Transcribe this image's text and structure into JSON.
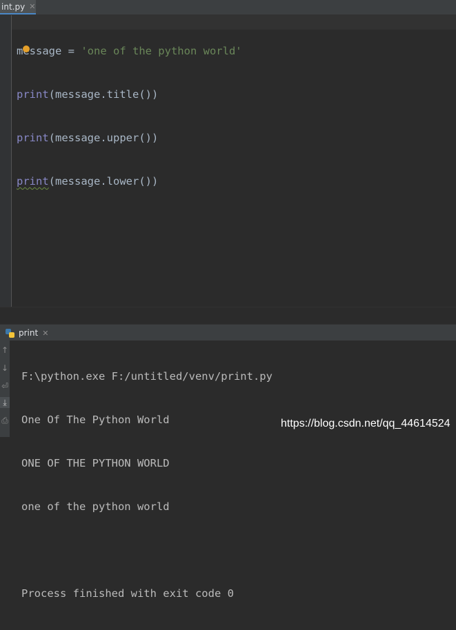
{
  "editor_tab": {
    "label": "int.py",
    "close": "✕"
  },
  "code": {
    "line1": {
      "var": "message = ",
      "str": "'one of the python world'"
    },
    "line2": {
      "kw": "print",
      "rest": "(message.title())"
    },
    "line3": {
      "kw": "print",
      "rest": "(message.upper())"
    },
    "line4": {
      "kw": "print",
      "rest": "(message.lower())"
    }
  },
  "run_tab": {
    "label": "print",
    "close": "✕"
  },
  "console": {
    "lines": [
      "F:\\python.exe F:/untitled/venv/print.py",
      "One Of The Python World",
      "ONE OF THE PYTHON WORLD",
      "one of the python world",
      "",
      "Process finished with exit code 0"
    ]
  },
  "tools": {
    "up": "↑",
    "down": "↓",
    "wrap": "⏎",
    "scroll_end": "⤓",
    "print": "⎙"
  },
  "watermark": "https://blog.csdn.net/qq_44614524"
}
